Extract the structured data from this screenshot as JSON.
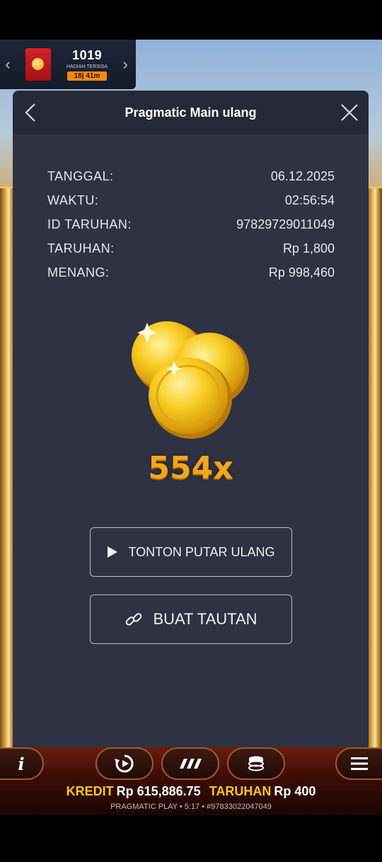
{
  "prize_widget": {
    "count": "1019",
    "label": "HADIAH TERSISA",
    "timer": "18j 41m"
  },
  "modal": {
    "title": "Pragmatic Main ulang",
    "rows": [
      {
        "label": "TANGGAL:",
        "value": "06.12.2025"
      },
      {
        "label": "WAKTU:",
        "value": "02:56:54"
      },
      {
        "label": "ID TARUHAN:",
        "value": "97829729011049"
      },
      {
        "label": "TARUHAN:",
        "value": "Rp 1,800"
      },
      {
        "label": "MENANG:",
        "value": "Rp 998,460"
      }
    ],
    "multiplier": "554x",
    "replay_button": "TONTON PUTAR ULANG",
    "link_button": "BUAT TAUTAN"
  },
  "bottom_bar": {
    "credit_label": "KREDIT",
    "credit_value": "Rp 615,886.75",
    "bet_label": "TARUHAN",
    "bet_value": "Rp 400",
    "footer": "PRAGMATIC PLAY • 5:17 • #97833022047049"
  },
  "colors": {
    "modal_bg": "#2e3242",
    "header_bg": "#252938",
    "multiplier": "#f2a71c",
    "credit_label": "#ffc61a",
    "timer_bg": "#f28a12"
  },
  "icons": [
    "chevron-left-icon",
    "chevron-right-icon",
    "back-icon",
    "close-icon",
    "play-icon",
    "link-icon",
    "info-icon",
    "autoplay-icon",
    "turbo-icon",
    "coins-stack-icon",
    "menu-icon"
  ]
}
